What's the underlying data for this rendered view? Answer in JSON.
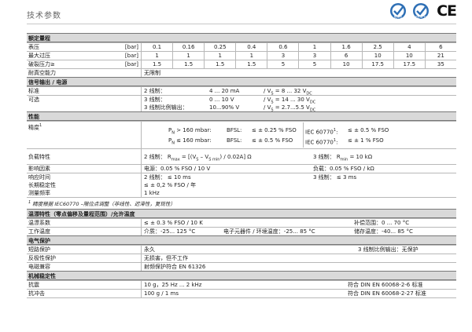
{
  "header": {
    "title": "技术参数",
    "cert_rohs": "RoHS",
    "cert_reach": "REACH",
    "ce": "CE"
  },
  "sections": {
    "rated": "额定量程",
    "signal": "信号输出 / 电源",
    "performance": "性能",
    "temp": "温漂特性（零点偏移及量程范围）/允许温度",
    "electrical": "电气保护",
    "mechanical": "机械稳定性"
  },
  "rated": {
    "rows": [
      {
        "label": "表压",
        "unit": "[bar]",
        "values": [
          "0.1",
          "0.16",
          "0.25",
          "0.4",
          "0.6",
          "1",
          "1.6",
          "2.5",
          "4",
          "6"
        ]
      },
      {
        "label": "最大过压",
        "unit": "[bar]",
        "values": [
          "1",
          "1",
          "1",
          "1",
          "3",
          "3",
          "6",
          "10",
          "10",
          "21"
        ]
      },
      {
        "label": "破裂压力≥",
        "unit": "[bar]",
        "values": [
          "1.5",
          "1.5",
          "1.5",
          "1.5",
          "5",
          "5",
          "10",
          "17.5",
          "17.5",
          "35"
        ]
      }
    ],
    "vacuum_label": "耐真空能力",
    "vacuum_value": "无限制"
  },
  "signal": {
    "standard_label": "标准",
    "standard_wire": "2 线制：",
    "standard_range": "4 ... 20 mA",
    "standard_vs": "/ V",
    "standard_vs_sub": "S",
    "standard_vs_val": " = 8 ... 32 V",
    "standard_vs_unit": "DC",
    "optional_label": "可选",
    "opt1_wire": "3 线制：",
    "opt1_range": "0 ... 10 V",
    "opt1_vs": "/ V",
    "opt1_vs_sub": "S",
    "opt1_vs_val": " = 14 ... 30 V",
    "opt1_vs_unit": "DC",
    "opt2_wire": "3 线制比例输出：",
    "opt2_range": "10...90% V",
    "opt2_vs": "/ V",
    "opt2_vs_sub": "S",
    "opt2_vs_val": " = 2.7...5.5 V",
    "opt2_vs_unit": "DC"
  },
  "performance": {
    "accuracy_label": "精度",
    "accuracy_sup": "1",
    "acc_r1_p": "P",
    "acc_r1_psub": "N",
    "acc_r1_cond": " > 160 mbar:",
    "acc_r1_bfsl": "BFSL:",
    "acc_r1_val": "≤ ± 0.25 % FSO",
    "acc_r1_iec": "IEC 60770",
    "acc_r1_iec_sup": "1",
    "acc_r1_iec_val": "≤ ± 0.5 % FSO",
    "acc_r2_p": "P",
    "acc_r2_psub": "N",
    "acc_r2_cond": " ≤ 160 mbar:",
    "acc_r2_bfsl": "BFSL:",
    "acc_r2_val": "≤ ± 0.5 % FSO",
    "acc_r2_iec": "IEC 60770",
    "acc_r2_iec_sup": "1",
    "acc_r2_iec_val": "≤ ± 1 % FSO",
    "load_label": "负载特性",
    "load_2w": "2 线制：  R",
    "load_2w_sub": "max",
    "load_2w_val": " = [(V",
    "load_2w_s": "S",
    "load_2w_mid": " – V",
    "load_2w_smin": "S min",
    "load_2w_end": ") / 0.02A] Ω",
    "load_3w": "3 线制：  R",
    "load_3w_sub": "min",
    "load_3w_val": " = 10 kΩ",
    "influence_label": "影响因素",
    "influence_supply": "电源：0.05 % FSO / 10 V",
    "influence_load": "负载：0.05 % FSO / kΩ",
    "response_label": "响应时间",
    "response_2w": "2 线制：  ≤ 10 ms",
    "response_3w": "3 线制：  ≤ 3 ms",
    "stability_label": "长期稳定性",
    "stability_value": "≤ ± 0,2 % FSO / 年",
    "sampling_label": "测量频率",
    "sampling_value": "1 kHz",
    "note_sup": "1",
    "note": " 精度根据 IEC60770 –限位点调整（非线性、迟滞性，复现性）"
  },
  "temp": {
    "drift_label": "温漂系数",
    "drift_value": "≤ ± 0.3 % FSO / 10 K",
    "comp_range": "补偿范围：0 ... 70 °C",
    "temp_label": "工作温度",
    "medium": "介质：-25... 125 °C",
    "electronics": "电子元器件 / 环境温度：-25... 85 °C",
    "storage": "储存温度：-40... 85 °C"
  },
  "electrical": {
    "short_label": "短路保护",
    "short_value": "永久",
    "short_note": "3 线制比例输出：无保护",
    "reverse_label": "反极性保护",
    "reverse_value": "无损害，但不工作",
    "emc_label": "电磁兼容",
    "emc_value": "射频保护符合 EN 61326"
  },
  "mechanical": {
    "vibration_label": "抗震",
    "vibration_value": "10 g，25 Hz ... 2 kHz",
    "vibration_std": "符合 DIN EN 60068-2-6 标准",
    "shock_label": "抗冲击",
    "shock_value": "100 g / 1 ms",
    "shock_std": "符合 DIN EN 60068-2-27 标准"
  },
  "colors": {
    "section_bg": "#d9d9d9",
    "rohs": "#2e6fb5",
    "reach": "#2e6fb5"
  }
}
